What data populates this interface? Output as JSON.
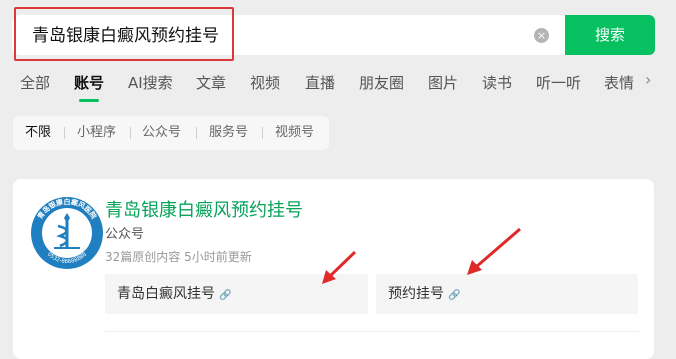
{
  "search": {
    "query": "青岛银康白癜风预约挂号",
    "button_label": "搜索",
    "clear_symbol": "×"
  },
  "tabs": [
    {
      "label": "全部",
      "active": false
    },
    {
      "label": "账号",
      "active": true
    },
    {
      "label": "AI搜索",
      "active": false
    },
    {
      "label": "文章",
      "active": false
    },
    {
      "label": "视频",
      "active": false
    },
    {
      "label": "直播",
      "active": false
    },
    {
      "label": "朋友圈",
      "active": false
    },
    {
      "label": "图片",
      "active": false
    },
    {
      "label": "读书",
      "active": false
    },
    {
      "label": "听一听",
      "active": false
    },
    {
      "label": "表情",
      "active": false
    }
  ],
  "tabs_more_symbol": "›",
  "filters": [
    {
      "label": "不限",
      "active": true
    },
    {
      "label": "小程序",
      "active": false
    },
    {
      "label": "公众号",
      "active": false
    },
    {
      "label": "服务号",
      "active": false
    },
    {
      "label": "视频号",
      "active": false
    }
  ],
  "result": {
    "name": "青岛银康白癜风预约挂号",
    "type": "公众号",
    "meta": "32篇原创内容  5小时前更新",
    "avatar_ring_text": "青岛银康白癜风医院",
    "avatar_phone": "0532-86688888",
    "services": [
      {
        "label": "青岛白癜风挂号"
      },
      {
        "label": "预约挂号"
      }
    ]
  },
  "colors": {
    "accent": "#07c160",
    "highlight": "#d9383c",
    "name": "#07a35a"
  }
}
